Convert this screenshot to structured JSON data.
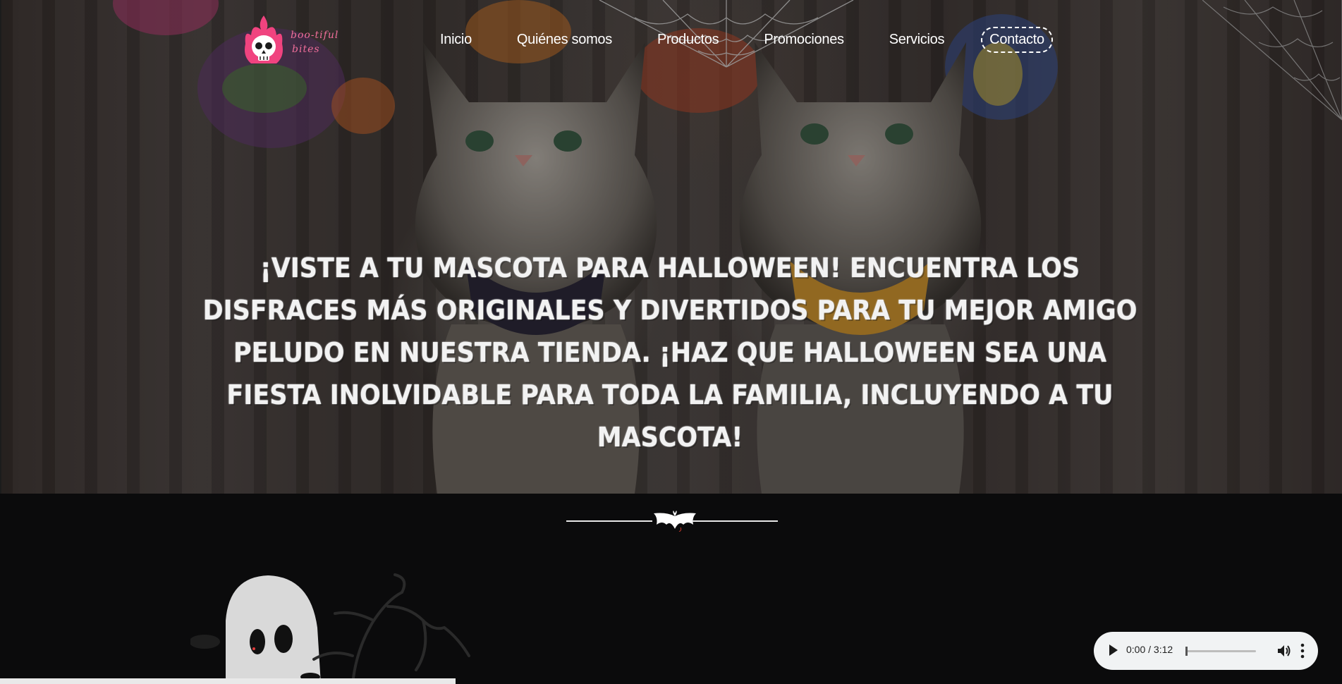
{
  "brand": {
    "logo_text_line1": "boo-tiful",
    "logo_text_line2": "bites",
    "accent": "#f0437f"
  },
  "nav": {
    "items": [
      {
        "label": "Inicio"
      },
      {
        "label": "Quiénes somos"
      },
      {
        "label": "Productos"
      },
      {
        "label": "Promociones"
      },
      {
        "label": "Servicios"
      }
    ],
    "contact_label": "Contacto"
  },
  "hero": {
    "text": "¡Viste a tu mascota para Halloween! Encuentra los disfraces más originales y divertidos para tu mejor amigo peludo en nuestra tienda. ¡Haz que Halloween sea una fiesta inolvidable para toda la familia, incluyendo a tu mascota!"
  },
  "audio_player": {
    "time": "0:00 / 3:12",
    "progress": 0
  },
  "icons": [
    "skull-flame-logo-icon",
    "bat-icon",
    "play-icon",
    "volume-icon",
    "more-vert-icon",
    "ghost-icon",
    "spiderweb-icon",
    "tree-icon"
  ]
}
